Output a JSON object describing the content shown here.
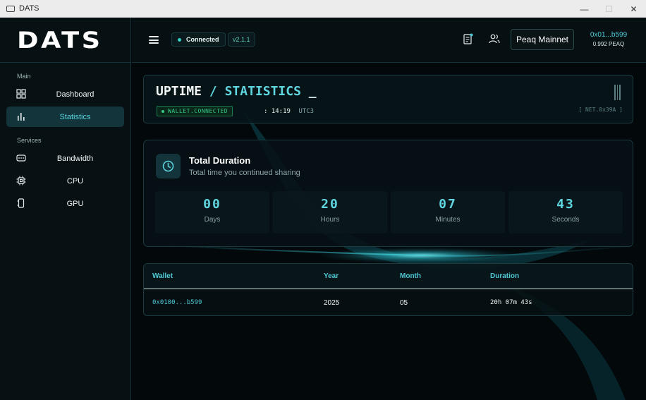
{
  "window": {
    "title": "DATS"
  },
  "sidebar": {
    "logo": "DATS",
    "sections": [
      {
        "label": "Main"
      },
      {
        "label": "Services"
      }
    ],
    "items": [
      {
        "label": "Dashboard",
        "icon": "dashboard-grid-icon"
      },
      {
        "label": "Statistics",
        "icon": "bar-chart-icon",
        "active": true
      },
      {
        "label": "Bandwidth",
        "icon": "router-icon"
      },
      {
        "label": "CPU",
        "icon": "cpu-chip-icon"
      },
      {
        "label": "GPU",
        "icon": "gpu-card-icon"
      }
    ]
  },
  "header": {
    "status": "Connected",
    "version": "v2.1.1",
    "network": "Peaq Mainnet",
    "wallet_address": "0x01...b599",
    "wallet_balance": "0.992 PEAQ"
  },
  "banner": {
    "title_part1": "UPTIME",
    "slash": "/",
    "title_part2": "STATISTICS",
    "cursor": "_",
    "wallet_status": "WALLET.CONNECTED",
    "time_sep": ":",
    "time": "14:19",
    "timezone": "UTC3",
    "net_code": "[ NET.0x39A ]"
  },
  "duration": {
    "title": "Total Duration",
    "subtitle": "Total time you continued sharing",
    "cells": [
      {
        "value": "00",
        "label": "Days"
      },
      {
        "value": "20",
        "label": "Hours"
      },
      {
        "value": "07",
        "label": "Minutes"
      },
      {
        "value": "43",
        "label": "Seconds"
      }
    ]
  },
  "table": {
    "headers": [
      "Wallet",
      "Year",
      "Month",
      "Duration"
    ],
    "rows": [
      {
        "wallet": "0x0100...b599",
        "year": "2025",
        "month": "05",
        "duration": "20h 07m 43s"
      }
    ]
  },
  "colors": {
    "accent": "#5fd6e0",
    "success": "#36c985",
    "background": "#03080a"
  }
}
